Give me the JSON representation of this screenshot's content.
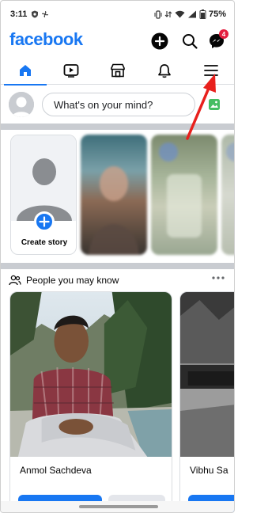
{
  "status_bar": {
    "time": "3:11",
    "battery": "75%"
  },
  "header": {
    "logo": "facebook",
    "messenger_badge_count": "4"
  },
  "tabs": [
    {
      "name": "home",
      "icon": "home-icon",
      "active": true
    },
    {
      "name": "video",
      "icon": "video-icon",
      "active": false
    },
    {
      "name": "marketplace",
      "icon": "marketplace-icon",
      "active": false
    },
    {
      "name": "notifications",
      "icon": "bell-icon",
      "active": false
    },
    {
      "name": "menu",
      "icon": "hamburger-menu-icon",
      "active": false
    }
  ],
  "composer": {
    "placeholder": "What's on your mind?"
  },
  "stories": {
    "create_label": "Create story"
  },
  "pymk": {
    "title": "People you may know",
    "people": [
      {
        "name": "Anmol Sachdeva"
      },
      {
        "name": "Vibhu Sa"
      }
    ]
  },
  "colors": {
    "brand": "#1877f2",
    "badge": "#e41e3f",
    "annotation_arrow": "#e8201c"
  }
}
